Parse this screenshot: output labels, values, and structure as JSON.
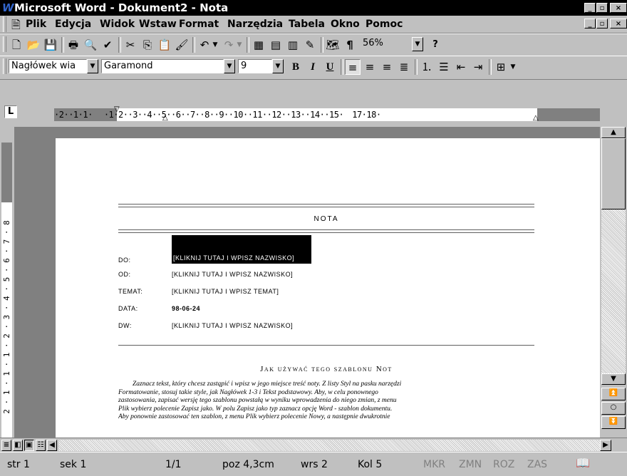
{
  "window": {
    "title": "Microsoft Word - Dokument2 - Nota",
    "app_icon": "word-icon"
  },
  "menu": [
    {
      "label": "Plik"
    },
    {
      "label": "Edycja"
    },
    {
      "label": "Widok"
    },
    {
      "label": "Wstaw"
    },
    {
      "label": "Format"
    },
    {
      "label": "Narzędzia"
    },
    {
      "label": "Tabela"
    },
    {
      "label": "Okno"
    },
    {
      "label": "Pomoc"
    }
  ],
  "toolbar_standard": {
    "zoom": "56%"
  },
  "toolbar_format": {
    "style": "Nagłówek wia",
    "font": "Garamond",
    "size": "9"
  },
  "ruler": {
    "labels": [
      "·2·",
      "·1·",
      "1·",
      "·1·",
      "2·",
      "·3·",
      "·4·",
      "·5·",
      "·6·",
      "·7·",
      "·8·",
      "·9·",
      "·10·",
      "·11·",
      "·12·",
      "·13·",
      "·14·",
      "·15·",
      "17·",
      "18·"
    ]
  },
  "vruler": {
    "text": "2 · 1 · 1 · 1 · 2 · 3 · 4 · 5 · 6 · 7 · 8"
  },
  "document": {
    "heading": "NOTA",
    "fields": [
      {
        "label": "DO:",
        "value": "[KLIKNIJ TUTAJ I WPISZ NAZWISKO]"
      },
      {
        "label": "OD:",
        "value": "[KLIKNIJ TUTAJ I WPISZ NAZWISKO]"
      },
      {
        "label": "TEMAT:",
        "value": "[KLIKNIJ TUTAJ I WPISZ TEMAT]"
      },
      {
        "label": "DATA:",
        "value": "98-06-24"
      },
      {
        "label": "DW:",
        "value": "[KLIKNIJ TUTAJ I WPISZ NAZWISKO]"
      }
    ],
    "section_title": "Jak używać tego szablonu Not",
    "body": [
      "Zaznacz tekst, który chcesz zastąpić i wpisz w jego miejsce treść noty. Z listy Styl na pasku narzędzi",
      "Formatowanie, stosuj takie style, jak Nagłówek 1-3 i Tekst podstawowy. Aby, w celu ponownego",
      "zastosowania, zapisać wersję tego szablonu powstałą w wyniku wprowadzenia do niego zmian, z menu",
      "Plik wybierz polecenie Zapisz jako. W polu Zapisz jako typ zaznacz opcję Word - szablon dokumentu.",
      "Aby ponownie zastosować ten szablon, z menu Plik wybierz polecenie Nowy, a następnie dwukrotnie"
    ]
  },
  "status": {
    "page": "str 1",
    "section": "sek 1",
    "pages": "1/1",
    "position": "poz 4,3cm",
    "line": "wrs 2",
    "column": "Kol 5",
    "mkr": "MKR",
    "zmn": "ZMN",
    "roz": "ROZ",
    "zas": "ZAS"
  }
}
